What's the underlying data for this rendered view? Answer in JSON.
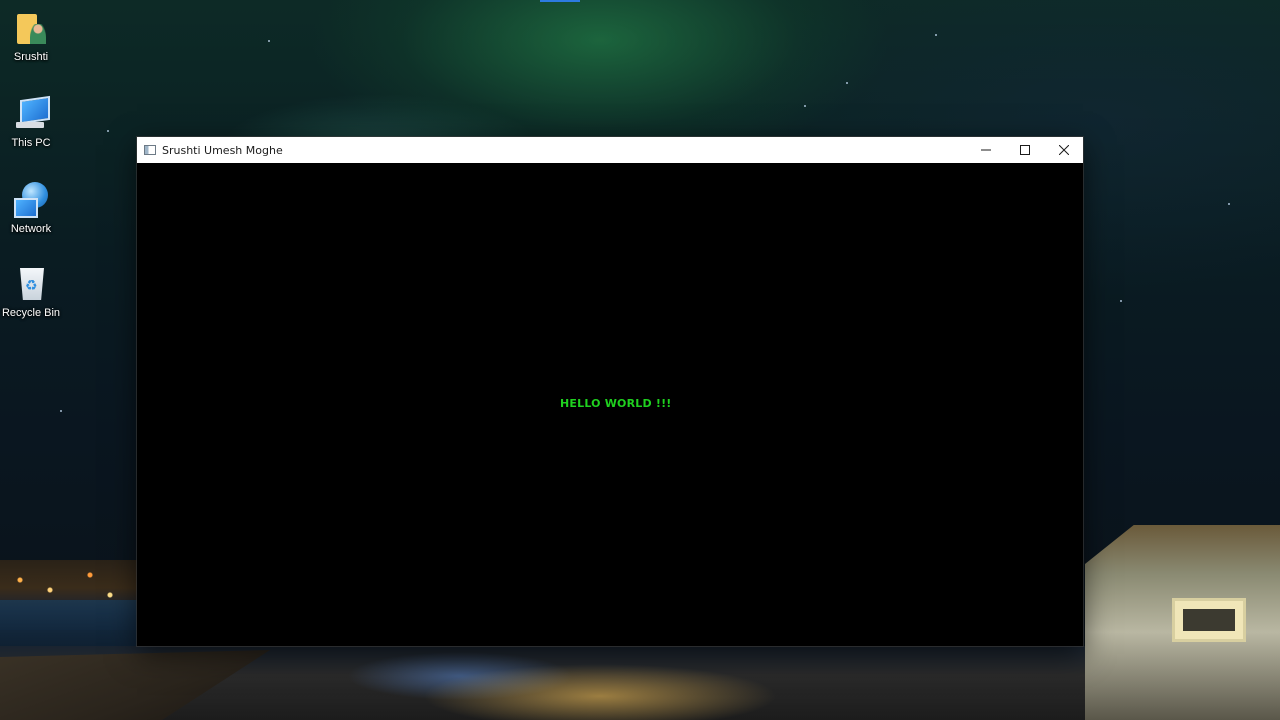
{
  "desktop": {
    "icons": [
      {
        "label": "Srushti",
        "icon": "user-folder-icon"
      },
      {
        "label": "This PC",
        "icon": "computer-icon"
      },
      {
        "label": "Network",
        "icon": "network-icon"
      },
      {
        "label": "Recycle Bin",
        "icon": "recycle-bin-icon"
      }
    ]
  },
  "window": {
    "title": "Srushti Umesh Moghe",
    "app_icon": "application-window-icon",
    "controls": {
      "minimize": "minimize-icon",
      "maximize": "maximize-icon",
      "close": "close-icon"
    },
    "content": {
      "text": "HELLO WORLD !!!",
      "text_color": "#1fd11f",
      "background": "#000000"
    }
  }
}
